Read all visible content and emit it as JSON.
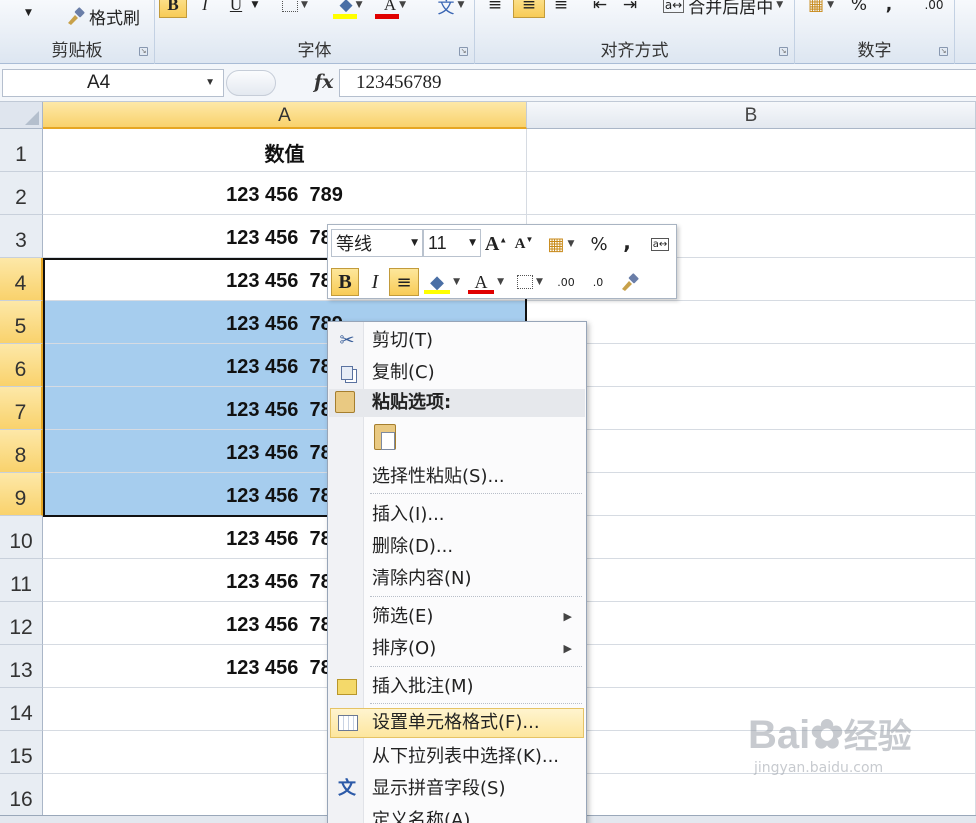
{
  "ribbon": {
    "clipboard": {
      "label": "剪贴板",
      "format_painter": "格式刷"
    },
    "font": {
      "label": "字体",
      "bold": "B",
      "italic": "I",
      "underline": "U"
    },
    "alignment": {
      "label": "对齐方式",
      "merge": "合并后居中"
    },
    "number": {
      "label": "数字",
      "percent": "%",
      "comma": ","
    }
  },
  "formula_bar": {
    "name_box": "A4",
    "fx": "fx",
    "value": "123456789"
  },
  "columns": [
    "A",
    "B"
  ],
  "rows": [
    {
      "n": "1",
      "a": "数值"
    },
    {
      "n": "2",
      "a": "123 456  789"
    },
    {
      "n": "3",
      "a": "123 456  789"
    },
    {
      "n": "4",
      "a": "123 456  789"
    },
    {
      "n": "5",
      "a": "123 456  789"
    },
    {
      "n": "6",
      "a": "123 456  789"
    },
    {
      "n": "7",
      "a": "123 456  789"
    },
    {
      "n": "8",
      "a": "123 456  789"
    },
    {
      "n": "9",
      "a": "123 456  789"
    },
    {
      "n": "10",
      "a": "123 456  789"
    },
    {
      "n": "11",
      "a": "123 456  789"
    },
    {
      "n": "12",
      "a": "123 456  789"
    },
    {
      "n": "13",
      "a": "123 456  789"
    },
    {
      "n": "14",
      "a": ""
    },
    {
      "n": "15",
      "a": ""
    },
    {
      "n": "16",
      "a": ""
    }
  ],
  "mini_toolbar": {
    "font_name": "等线",
    "font_size": "11",
    "percent": "%",
    "comma": ",",
    "bold": "B",
    "italic": "I"
  },
  "context_menu": {
    "cut": "剪切(T)",
    "copy": "复制(C)",
    "paste_options": "粘贴选项:",
    "paste_special": "选择性粘贴(S)...",
    "insert": "插入(I)...",
    "delete": "删除(D)...",
    "clear_contents": "清除内容(N)",
    "filter": "筛选(E)",
    "sort": "排序(O)",
    "insert_comment": "插入批注(M)",
    "format_cells": "设置单元格格式(F)...",
    "pick_from_list": "从下拉列表中选择(K)...",
    "phonetic": "显示拼音字段(S)",
    "define_name": "定义名称(A)..."
  },
  "watermark": {
    "brand": "Bai",
    "brand2": "经验",
    "url": "jingyan.baidu.com"
  },
  "colors": {
    "selection": "#a6cdee",
    "header_selected": "#f9d26c",
    "menu_hover": "#fde69e"
  }
}
